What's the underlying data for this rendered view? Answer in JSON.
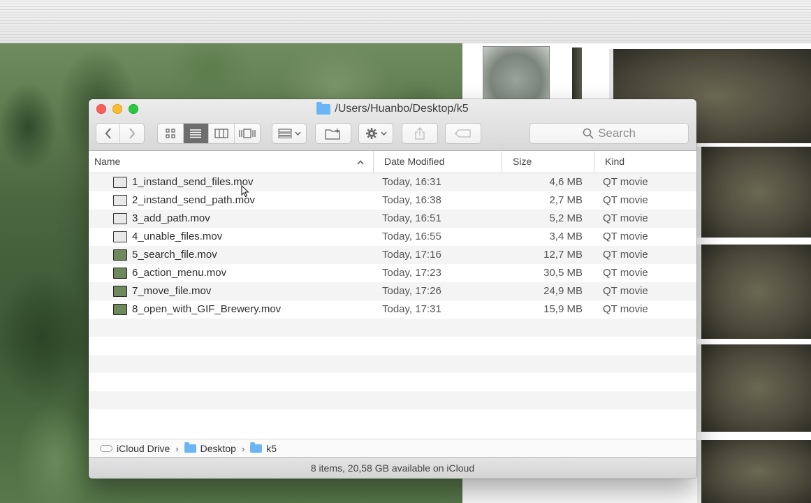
{
  "window": {
    "title": "/Users/Huanbo/Desktop/k5",
    "title_icon": "folder-icon"
  },
  "toolbar": {
    "back_icon": "chevron-left-icon",
    "forward_icon": "chevron-right-icon",
    "view_icons": [
      "icon-view-icon",
      "list-view-icon",
      "column-view-icon",
      "cover-flow-icon"
    ],
    "active_view": "list-view-icon",
    "arrange_icon": "arrange-grid-icon",
    "new_folder_icon": "new-folder-icon",
    "action_icon": "gear-icon",
    "share_icon": "share-icon",
    "tags_icon": "tag-icon",
    "search_placeholder": "Search"
  },
  "columns": {
    "name": "Name",
    "sort_indicator": "^",
    "date": "Date Modified",
    "size": "Size",
    "kind": "Kind"
  },
  "files": [
    {
      "name": "1_instand_send_files.mov",
      "date": "Today, 16:31",
      "size": "4,6 MB",
      "kind": "QT movie",
      "thumb": "light"
    },
    {
      "name": "2_instand_send_path.mov",
      "date": "Today, 16:38",
      "size": "2,7 MB",
      "kind": "QT movie",
      "thumb": "light"
    },
    {
      "name": "3_add_path.mov",
      "date": "Today, 16:51",
      "size": "5,2 MB",
      "kind": "QT movie",
      "thumb": "light"
    },
    {
      "name": "4_unable_files.mov",
      "date": "Today, 16:55",
      "size": "3,4 MB",
      "kind": "QT movie",
      "thumb": "light"
    },
    {
      "name": "5_search_file.mov",
      "date": "Today, 17:16",
      "size": "12,7 MB",
      "kind": "QT movie",
      "thumb": "dark"
    },
    {
      "name": "6_action_menu.mov",
      "date": "Today, 17:23",
      "size": "30,5 MB",
      "kind": "QT movie",
      "thumb": "dark"
    },
    {
      "name": "7_move_file.mov",
      "date": "Today, 17:26",
      "size": "24,9 MB",
      "kind": "QT movie",
      "thumb": "dark"
    },
    {
      "name": "8_open_with_GIF_Brewery.mov",
      "date": "Today, 17:31",
      "size": "15,9 MB",
      "kind": "QT movie",
      "thumb": "dark"
    }
  ],
  "pathbar": {
    "items": [
      "iCloud Drive",
      "Desktop",
      "k5"
    ],
    "separator": "›"
  },
  "status": {
    "text": "8 items, 20,58 GB available on iCloud"
  }
}
